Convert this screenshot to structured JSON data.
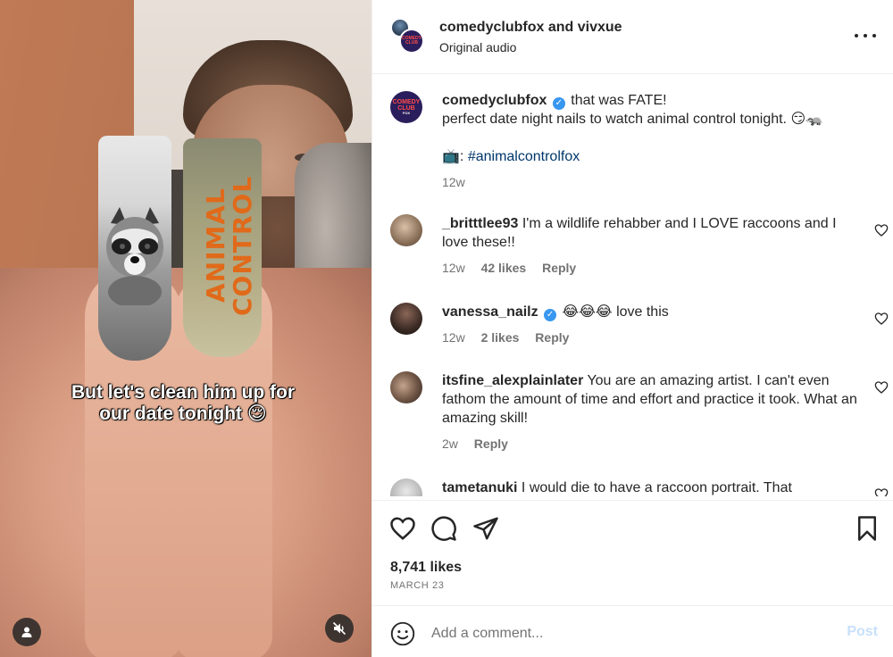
{
  "media": {
    "caption_line1": "But let's clean him up for",
    "caption_line2": "our date tonight 😌",
    "nail_text": "ANIMAL CONTROL",
    "user_icon": "user-icon",
    "mute_icon": "muted-speaker-icon"
  },
  "header": {
    "user1": "comedyclubfox",
    "and": "and",
    "user2": "vivxue",
    "audio": "Original audio",
    "logo_line1": "COMEDY",
    "logo_line2": "CLUB",
    "logo_line3": "FOX"
  },
  "caption": {
    "username": "comedyclubfox",
    "text_line1": "that was FATE!",
    "text_line2": "perfect date night nails to watch animal control tonight. 😏🦡",
    "tv_emoji": "📺",
    "colon": ":",
    "hashtag": "#animalcontrolfox",
    "time": "12w"
  },
  "comments": [
    {
      "username": "_britttlee93",
      "text": "I'm a wildlife rehabber and I LOVE raccoons and I love these!!",
      "time": "12w",
      "likes": "42 likes",
      "reply": "Reply"
    },
    {
      "username": "vanessa_nailz",
      "text": "😂😂😂 love this",
      "time": "12w",
      "likes": "2 likes",
      "reply": "Reply"
    },
    {
      "username": "itsfine_alexplainlater",
      "text": "You are an amazing artist. I can't even fathom the amount of time and effort and practice it took. What an amazing skill!",
      "time": "2w",
      "reply": "Reply"
    },
    {
      "username": "tametanuki",
      "text": "I would die to have a raccoon portrait. That"
    }
  ],
  "actions": {
    "likes": "8,741 likes",
    "date": "MARCH 23"
  },
  "composer": {
    "placeholder": "Add a comment...",
    "post": "Post"
  },
  "colors": {
    "link": "#00376b",
    "verified": "#3897f0",
    "muted": "#737373",
    "post_disabled": "#c7e0fb"
  }
}
